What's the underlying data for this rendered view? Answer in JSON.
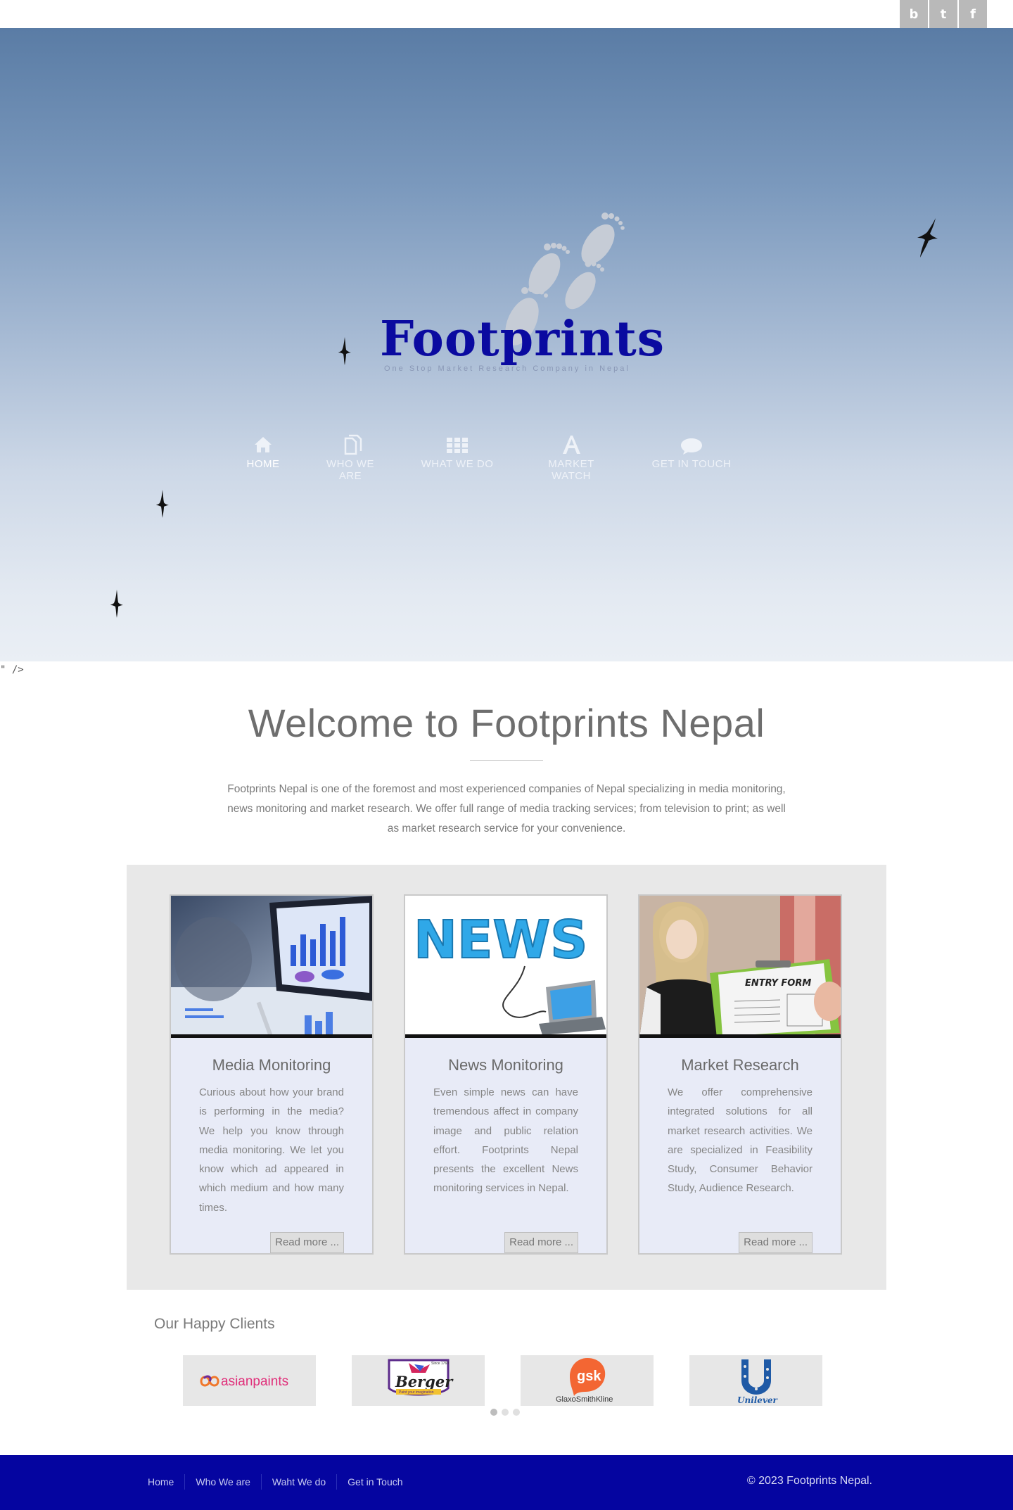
{
  "social": {
    "icons": [
      "blogger-icon",
      "twitter-icon",
      "facebook-icon"
    ],
    "glyphs": [
      "b",
      "t",
      "f"
    ]
  },
  "brand": {
    "name": "Footprints",
    "tagline": "One Stop Market Research Company in Nepal",
    "color": "#0a0aa0"
  },
  "nav": {
    "items": [
      {
        "label": "HOME",
        "icon": "home-icon",
        "active": true
      },
      {
        "label": "WHO WE ARE",
        "icon": "documents-icon",
        "active": false
      },
      {
        "label": "WHAT WE DO",
        "icon": "grid-icon",
        "active": false
      },
      {
        "label": "MARKET WATCH",
        "icon": "font-a-icon",
        "active": false
      },
      {
        "label": "GET IN TOUCH",
        "icon": "chat-bubble-icon",
        "active": false
      }
    ]
  },
  "stray_text": "\" />",
  "welcome": {
    "title": "Welcome to Footprints Nepal",
    "text": "Footprints Nepal is one of the foremost and most experienced companies of Nepal specializing in media monitoring, news monitoring and market research. We offer full range of media tracking services; from television to print; as well as market research service for your convenience."
  },
  "services": [
    {
      "title": "Media Monitoring",
      "text": "Curious about how your brand is performing in the media? We help you know through media monitoring. We let you know which ad appeared in which medium and how many times.",
      "button": "Read more ..."
    },
    {
      "title": "News Monitoring",
      "text": "Even simple news can have tremendous affect in company image and public relation effort. Footprints Nepal presents the excellent News monitoring services in Nepal.",
      "button": "Read more ..."
    },
    {
      "title": "Market Research",
      "text": "We offer comprehensive integrated solutions for all market research activities. We are specialized in Feasibility Study, Consumer Behavior Study, Audience Research.",
      "button": "Read more ..."
    }
  ],
  "service_images": {
    "news_word": "NEWS",
    "form_title": "ENTRY FORM"
  },
  "clients": {
    "title": "Our Happy Clients",
    "logos": [
      {
        "name": "asianpaints",
        "text": "asianpaints"
      },
      {
        "name": "Berger",
        "text": "Berger",
        "sub": "Paint your imagination",
        "top": "Since 1760"
      },
      {
        "name": "GlaxoSmithKline",
        "text": "gsk",
        "sub": "GlaxoSmithKline"
      },
      {
        "name": "Unilever",
        "text": "Unilever"
      }
    ],
    "pages": 3,
    "current_page": 1
  },
  "footer": {
    "links": [
      "Home",
      "Who We are",
      "Waht We do",
      "Get in Touch"
    ],
    "copyright": "© 2023 Footprints Nepal."
  },
  "colors": {
    "footer_bg": "#0505a0",
    "card_bg": "#e8ebf7",
    "services_bg": "#e8e8e8"
  }
}
